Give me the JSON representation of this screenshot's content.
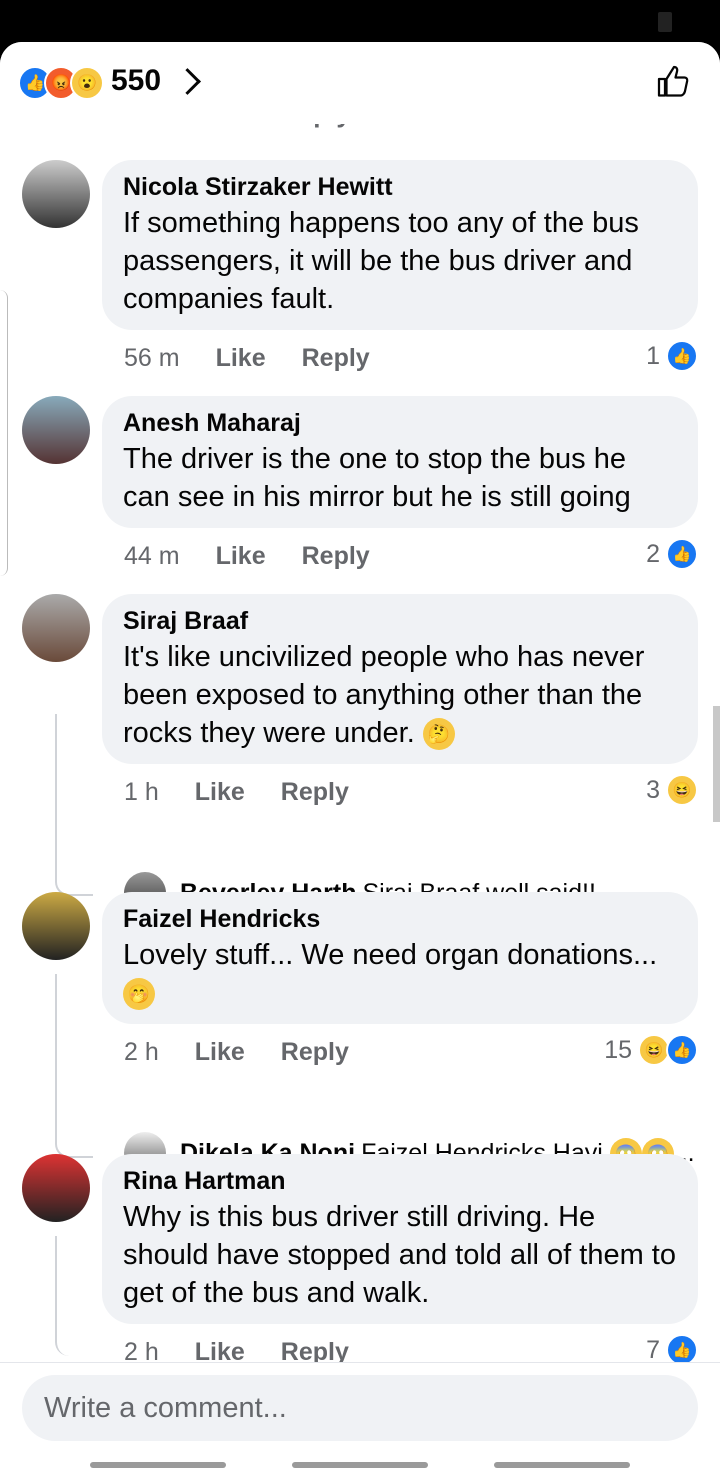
{
  "header": {
    "count": "550",
    "reactions": [
      "like-icon",
      "angry-icon",
      "wow-icon"
    ]
  },
  "cutoff_row": {
    "time": "2 h",
    "like": "Like",
    "reply": "Reply",
    "count": "7"
  },
  "comments": [
    {
      "name": "Nicola Stirzaker Hewitt",
      "text": "If something happens too any of the bus passengers, it will be the bus driver and companies fault.",
      "time": "56 m",
      "like": "Like",
      "reply": "Reply",
      "count": "1"
    },
    {
      "name": "Anesh Maharaj",
      "text": "The driver is  the one to stop the bus he can see in his mirror but he is still going",
      "time": "44 m",
      "like": "Like",
      "reply": "Reply",
      "count": "2"
    },
    {
      "name": "Siraj Braaf",
      "text": "It's like uncivilized people who has never been exposed to anything other than the rocks they were under.",
      "emoji": "🤔",
      "time": "1 h",
      "like": "Like",
      "reply": "Reply",
      "count": "3",
      "reply_preview": {
        "name": "Beverley Harth",
        "text": "Siraj Braaf well said!!"
      }
    },
    {
      "name": "Faizel Hendricks",
      "text": "Lovely stuff... We need organ donations...",
      "emoji": "🤭",
      "time": "2 h",
      "like": "Like",
      "reply": "Reply",
      "count": "15",
      "reply_preview": {
        "name": "Dikela Ka Noni",
        "text": "Faizel Hendricks Hayi",
        "tail": "..."
      }
    },
    {
      "name": "Rina Hartman",
      "text": "Why is this bus driver still driving. He should have stopped and told all of them to get of the bus and walk.",
      "time": "2 h",
      "like": "Like",
      "reply": "Reply",
      "count": "7"
    }
  ],
  "composer": {
    "placeholder": "Write a comment..."
  }
}
